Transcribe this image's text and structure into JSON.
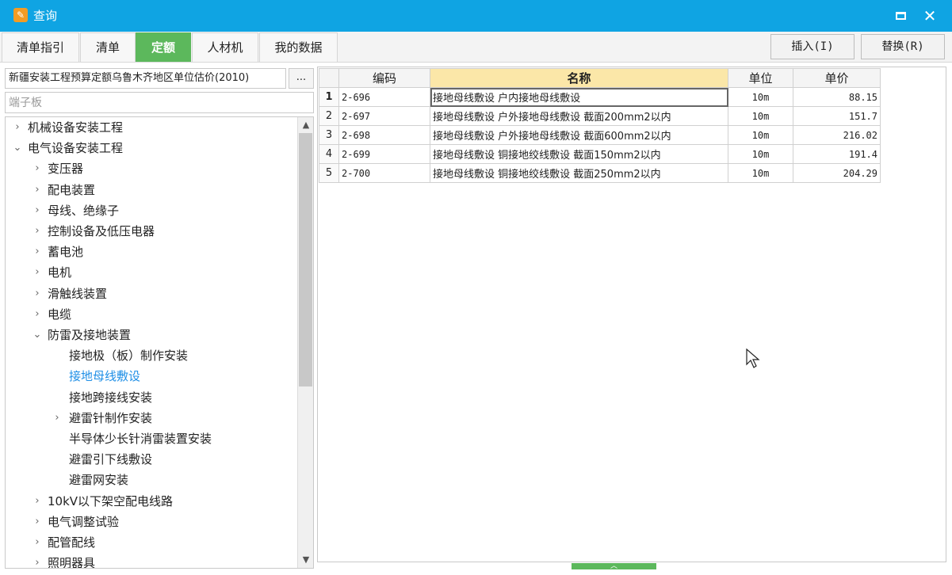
{
  "window": {
    "title": "查询",
    "icon": "app-icon"
  },
  "tabs": [
    {
      "label": "清单指引",
      "active": false
    },
    {
      "label": "清单",
      "active": false
    },
    {
      "label": "定额",
      "active": true
    },
    {
      "label": "人材机",
      "active": false
    },
    {
      "label": "我的数据",
      "active": false
    }
  ],
  "buttons": {
    "insert": "插入(I)",
    "replace": "替换(R)"
  },
  "library": {
    "name": "新疆安装工程预算定额乌鲁木齐地区单位估价(2010)",
    "browse": "..."
  },
  "search": {
    "placeholder": "端子板",
    "value": ""
  },
  "tree": [
    {
      "label": "机械设备安装工程",
      "level": 0,
      "arrow": "›"
    },
    {
      "label": "电气设备安装工程",
      "level": 0,
      "arrow": "⌄"
    },
    {
      "label": "变压器",
      "level": 1,
      "arrow": "›"
    },
    {
      "label": "配电装置",
      "level": 1,
      "arrow": "›"
    },
    {
      "label": "母线、绝缘子",
      "level": 1,
      "arrow": "›"
    },
    {
      "label": "控制设备及低压电器",
      "level": 1,
      "arrow": "›"
    },
    {
      "label": "蓄电池",
      "level": 1,
      "arrow": "›"
    },
    {
      "label": "电机",
      "level": 1,
      "arrow": "›"
    },
    {
      "label": "滑触线装置",
      "level": 1,
      "arrow": "›"
    },
    {
      "label": "电缆",
      "level": 1,
      "arrow": "›"
    },
    {
      "label": "防雷及接地装置",
      "level": 1,
      "arrow": "⌄"
    },
    {
      "label": "接地极（板）制作安装",
      "level": 2,
      "arrow": ""
    },
    {
      "label": "接地母线敷设",
      "level": 2,
      "arrow": "",
      "selected": true
    },
    {
      "label": "接地跨接线安装",
      "level": 2,
      "arrow": ""
    },
    {
      "label": "避雷针制作安装",
      "level": 2,
      "arrow": "›"
    },
    {
      "label": "半导体少长针消雷装置安装",
      "level": 2,
      "arrow": ""
    },
    {
      "label": "避雷引下线敷设",
      "level": 2,
      "arrow": ""
    },
    {
      "label": "避雷网安装",
      "level": 2,
      "arrow": ""
    },
    {
      "label": "10kV以下架空配电线路",
      "level": 1,
      "arrow": "›"
    },
    {
      "label": "电气调整试验",
      "level": 1,
      "arrow": "›"
    },
    {
      "label": "配管配线",
      "level": 1,
      "arrow": "›"
    },
    {
      "label": "照明器具",
      "level": 1,
      "arrow": "›"
    }
  ],
  "grid": {
    "columns": [
      "编码",
      "名称",
      "单位",
      "单价"
    ],
    "sorted_column": "名称",
    "rows": [
      {
        "n": "1",
        "code": "2-696",
        "name": "接地母线敷设 户内接地母线敷设",
        "unit": "10m",
        "price": "88.15",
        "current": true
      },
      {
        "n": "2",
        "code": "2-697",
        "name": "接地母线敷设 户外接地母线敷设 截面200mm2以内",
        "unit": "10m",
        "price": "151.7"
      },
      {
        "n": "3",
        "code": "2-698",
        "name": "接地母线敷设 户外接地母线敷设 截面600mm2以内",
        "unit": "10m",
        "price": "216.02"
      },
      {
        "n": "4",
        "code": "2-699",
        "name": "接地母线敷设 铜接地绞线敷设 截面150mm2以内",
        "unit": "10m",
        "price": "191.4"
      },
      {
        "n": "5",
        "code": "2-700",
        "name": "接地母线敷设 铜接地绞线敷设 截面250mm2以内",
        "unit": "10m",
        "price": "204.29"
      }
    ]
  },
  "colors": {
    "titlebar": "#0fa4e3",
    "active_tab": "#5cb85c",
    "selected_text": "#1f8fe6",
    "sorted_header": "#fbe7a8"
  }
}
